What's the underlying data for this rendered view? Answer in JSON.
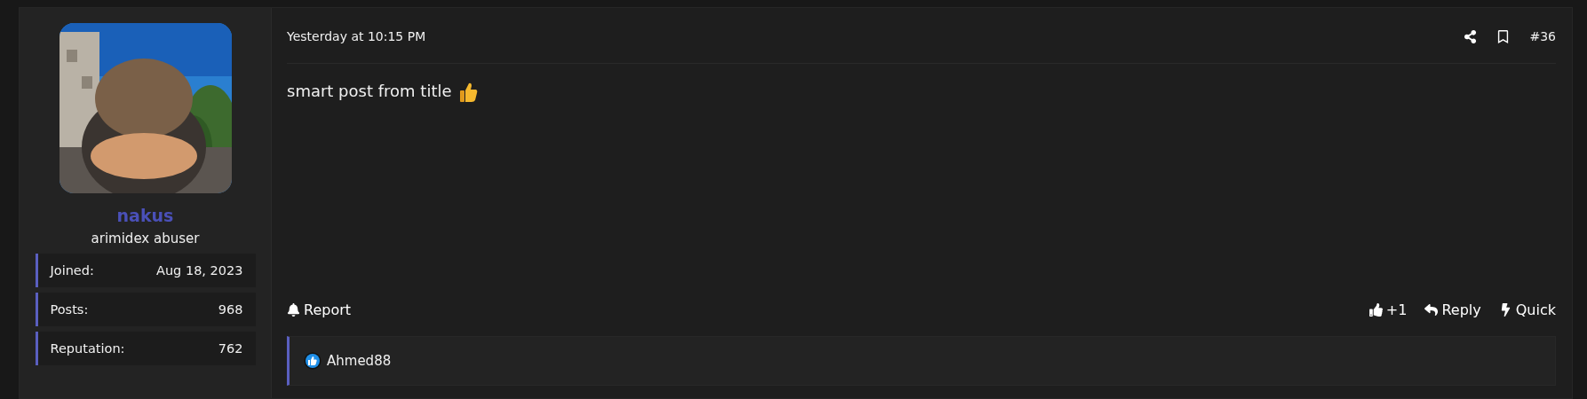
{
  "author": {
    "name": "nakus",
    "title": "arimidex abuser",
    "stats": [
      {
        "label": "Joined:",
        "value": "Aug 18, 2023"
      },
      {
        "label": "Posts:",
        "value": "968"
      },
      {
        "label": "Reputation:",
        "value": "762"
      }
    ]
  },
  "post": {
    "timestamp": "Yesterday at 10:15 PM",
    "number": "#36",
    "body": "smart post from title"
  },
  "actions_left": [
    {
      "kind": "report",
      "label": "Report"
    }
  ],
  "actions_right": [
    {
      "kind": "like",
      "label": "+1"
    },
    {
      "kind": "reply",
      "label": "Reply"
    },
    {
      "kind": "quick",
      "label": "Quick"
    }
  ],
  "reactions": {
    "users": [
      "Ahmed88"
    ]
  }
}
